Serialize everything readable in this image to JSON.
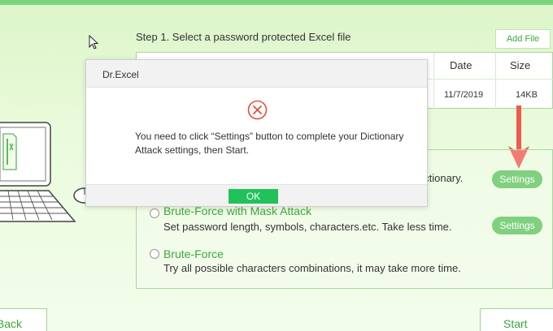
{
  "step": {
    "title": "Step 1. Select a password protected Excel file",
    "add_file_label": "Add File"
  },
  "file_table": {
    "headers": {
      "date": "Date",
      "size": "Size"
    },
    "rows": [
      {
        "date": "11/7/2019",
        "size": "14KB"
      }
    ]
  },
  "attack_modes": [
    {
      "name": "",
      "description": "dictionary.",
      "settings_label": "Settings"
    },
    {
      "name": "Brute-Force with Mask Attack",
      "description": "Set password length, symbols, characters.etc. Take less time.",
      "settings_label": "Settings"
    },
    {
      "name": "Brute-Force",
      "description": "Try all possible characters combinations, it may take more time."
    }
  ],
  "nav": {
    "back_label": "Back",
    "start_label": "Start"
  },
  "dialog": {
    "title": "Dr.Excel",
    "message": "You need to click “Settings” button to complete your Dictionary Attack settings, then Start.",
    "ok_label": "OK"
  },
  "colors": {
    "accent_green": "#7fd07f",
    "link_green": "#3aa93a",
    "ok_green": "#22c25a",
    "error_red": "#e74c3c",
    "arrow_red": "#ef5a4f"
  },
  "icons": {
    "dialog_icon": "error-circle-x-icon",
    "cursor": "mouse-pointer-icon",
    "illustration": "laptop-with-excel-file-illustration",
    "hint": "red-down-arrow-icon"
  }
}
